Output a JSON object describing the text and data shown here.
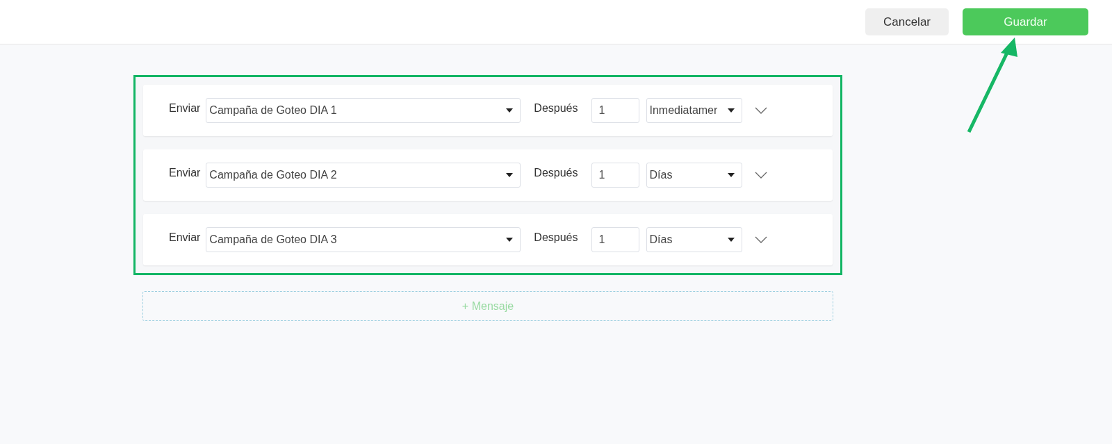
{
  "header": {
    "buttons": [
      {
        "label": "Cancelar",
        "kind": "secondary"
      },
      {
        "label": "Guardar",
        "kind": "primary"
      }
    ]
  },
  "messages": [
    {
      "send_label": "Enviar",
      "campaign": "Campaña de Goteo DIA 1",
      "after_label": "Después",
      "amount": "1",
      "unit": "Inmediatamer"
    },
    {
      "send_label": "Enviar",
      "campaign": "Campaña de Goteo DIA 2",
      "after_label": "Después",
      "amount": "1",
      "unit": "Días"
    },
    {
      "send_label": "Enviar",
      "campaign": "Campaña de Goteo DIA 3",
      "after_label": "Después",
      "amount": "1",
      "unit": "Días"
    }
  ],
  "add_button": "+ Mensaje"
}
